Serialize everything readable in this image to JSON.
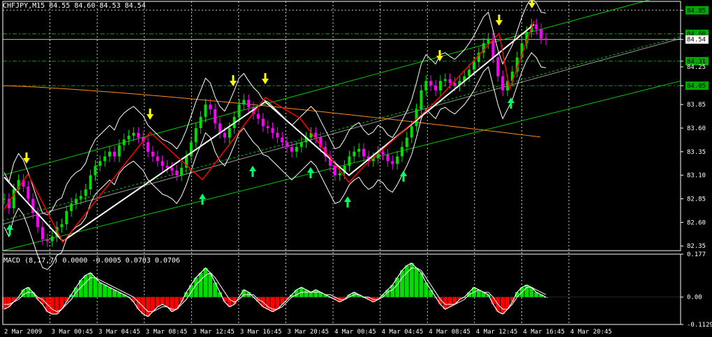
{
  "header": {
    "symbol": "CHFJPY,M15",
    "quote": "84.55 84.60 84.53 84.54"
  },
  "macd_header": {
    "name": "MACD",
    "params": "(8,17,7)",
    "values": "0.0000 -0.0005 0.0703 0.0706"
  },
  "colors": {
    "background": "#000000",
    "axis": "#ffffff",
    "grid": "#ffffff",
    "bull_candle": "#00dd00",
    "bear_candle": "#ff00ff",
    "zigzag_white": "#ffffff",
    "zigzag_red": "#ff0000",
    "channel": "#00cc00",
    "fib_lines": "#00aa00",
    "ma_orange": "#ff8c1a",
    "bollinger": "#ffffff",
    "arrow_down": "#ffff00",
    "arrow_up": "#00ff66",
    "macd_pos": "#00dd00",
    "macd_neg": "#ff0000",
    "price_tag": "#00aa00"
  },
  "chart_data": [
    {
      "type": "candlestick",
      "title": "CHFJPY,M15",
      "x_tick_labels": [
        "2 Mar 2009",
        "3 Mar 00:45",
        "3 Mar 04:45",
        "3 Mar 08:45",
        "3 Mar 12:45",
        "3 Mar 16:45",
        "3 Mar 20:45",
        "4 Mar 00:45",
        "4 Mar 04:45",
        "4 Mar 08:45",
        "4 Mar 12:45",
        "4 Mar 16:45",
        "4 Mar 20:45"
      ],
      "y_tick_labels": [
        "84.85",
        "84.60",
        "84.54",
        "84.31",
        "84.25",
        "84.05",
        "83.85",
        "83.60",
        "83.35",
        "83.10",
        "82.85",
        "82.60",
        "82.35"
      ],
      "ylim": [
        82.3,
        84.9
      ],
      "price_levels": {
        "top_tag": 84.85,
        "current_green": 84.6,
        "current_price": 84.54,
        "fib_1": 84.31,
        "fib_2": 84.05
      },
      "close_path": [
        82.85,
        82.75,
        82.95,
        83.05,
        82.98,
        82.85,
        82.7,
        82.55,
        82.42,
        82.4,
        82.45,
        82.55,
        82.58,
        82.72,
        82.8,
        82.85,
        82.88,
        82.95,
        83.1,
        83.2,
        83.25,
        83.3,
        83.35,
        83.3,
        83.42,
        83.48,
        83.52,
        83.55,
        83.5,
        83.45,
        83.35,
        83.3,
        83.25,
        83.2,
        83.18,
        83.15,
        83.1,
        83.18,
        83.3,
        83.45,
        83.6,
        83.72,
        83.85,
        83.8,
        83.65,
        83.55,
        83.5,
        83.6,
        83.72,
        83.85,
        83.9,
        83.82,
        83.75,
        83.7,
        83.62,
        83.6,
        83.55,
        83.5,
        83.45,
        83.4,
        83.35,
        83.4,
        83.45,
        83.5,
        83.55,
        83.5,
        83.4,
        83.3,
        83.2,
        83.1,
        83.12,
        83.2,
        83.3,
        83.35,
        83.38,
        83.3,
        83.25,
        83.28,
        83.35,
        83.32,
        83.25,
        83.22,
        83.3,
        83.4,
        83.5,
        83.62,
        83.8,
        84.0,
        84.1,
        84.05,
        84.0,
        84.1,
        84.12,
        84.08,
        84.05,
        84.1,
        84.15,
        84.22,
        84.3,
        84.4,
        84.5,
        84.55,
        84.35,
        84.15,
        84.0,
        84.1,
        84.2,
        84.35,
        84.5,
        84.62,
        84.7,
        84.65,
        84.55,
        84.54
      ],
      "zigzag_white": [
        {
          "x": "2 Mar 2009",
          "y": 83.08
        },
        {
          "x": "3 Mar 00:45",
          "y": 82.4
        },
        {
          "x": "3 Mar 20:45",
          "y": 83.88
        },
        {
          "x": "4 Mar 00:45",
          "y": 83.1
        },
        {
          "x": "4 Mar 16:45",
          "y": 84.7
        }
      ],
      "signals_down": [
        "2 Mar 2009",
        "3 Mar 08:45",
        "3 Mar 16:45",
        "3 Mar 16:45",
        "4 Mar 08:45",
        "4 Mar 16:45",
        "4 Mar 16:45"
      ],
      "signals_up": [
        "2 Mar 2009",
        "3 Mar 12:45",
        "3 Mar 16:45",
        "4 Mar 00:45",
        "4 Mar 04:45",
        "4 Mar 04:45",
        "4 Mar 16:45"
      ]
    },
    {
      "type": "bar",
      "title": "MACD (8,17,7)",
      "y_tick_labels": [
        "0.177",
        "0.00",
        "-0.1129"
      ],
      "ylim": [
        -0.1129,
        0.177
      ],
      "histogram": [
        -0.05,
        -0.04,
        -0.02,
        0.0,
        0.03,
        0.04,
        0.02,
        -0.01,
        -0.03,
        -0.06,
        -0.07,
        -0.07,
        -0.05,
        -0.02,
        0.01,
        0.04,
        0.07,
        0.09,
        0.1,
        0.08,
        0.06,
        0.05,
        0.04,
        0.03,
        0.02,
        0.01,
        0.0,
        -0.02,
        -0.05,
        -0.07,
        -0.08,
        -0.06,
        -0.04,
        -0.03,
        -0.04,
        -0.06,
        -0.05,
        -0.02,
        0.02,
        0.05,
        0.08,
        0.1,
        0.12,
        0.1,
        0.06,
        0.02,
        -0.02,
        -0.04,
        -0.03,
        0.0,
        0.03,
        0.02,
        0.0,
        -0.02,
        -0.04,
        -0.05,
        -0.06,
        -0.05,
        -0.03,
        -0.01,
        0.01,
        0.03,
        0.04,
        0.03,
        0.02,
        0.03,
        0.02,
        0.01,
        0.0,
        -0.01,
        -0.02,
        -0.01,
        0.01,
        0.02,
        0.01,
        0.0,
        -0.01,
        -0.02,
        -0.01,
        0.01,
        0.03,
        0.05,
        0.08,
        0.11,
        0.13,
        0.14,
        0.12,
        0.1,
        0.06,
        0.03,
        0.0,
        -0.03,
        -0.05,
        -0.04,
        -0.03,
        -0.01,
        0.0,
        0.02,
        0.04,
        0.03,
        0.02,
        0.01,
        -0.03,
        -0.06,
        -0.07,
        -0.05,
        -0.02,
        0.02,
        0.04,
        0.05,
        0.04,
        0.02,
        0.01,
        0.0
      ],
      "signal": [
        -0.03,
        -0.03,
        -0.02,
        -0.01,
        0.01,
        0.02,
        0.02,
        0.0,
        -0.01,
        -0.03,
        -0.05,
        -0.06,
        -0.05,
        -0.03,
        -0.01,
        0.02,
        0.04,
        0.06,
        0.08,
        0.08,
        0.07,
        0.06,
        0.05,
        0.04,
        0.03,
        0.02,
        0.01,
        0.0,
        -0.02,
        -0.04,
        -0.06,
        -0.06,
        -0.05,
        -0.04,
        -0.04,
        -0.05,
        -0.05,
        -0.03,
        -0.01,
        0.02,
        0.05,
        0.07,
        0.09,
        0.1,
        0.08,
        0.05,
        0.02,
        -0.01,
        -0.02,
        -0.01,
        0.01,
        0.01,
        0.01,
        -0.01,
        -0.02,
        -0.04,
        -0.05,
        -0.05,
        -0.04,
        -0.02,
        0.0,
        0.01,
        0.02,
        0.02,
        0.02,
        0.02,
        0.02,
        0.01,
        0.01,
        0.0,
        -0.01,
        -0.01,
        0.0,
        0.01,
        0.01,
        0.0,
        0.0,
        -0.01,
        -0.01,
        0.0,
        0.02,
        0.03,
        0.05,
        0.08,
        0.1,
        0.12,
        0.12,
        0.11,
        0.08,
        0.05,
        0.02,
        -0.01,
        -0.03,
        -0.03,
        -0.03,
        -0.02,
        -0.01,
        0.01,
        0.02,
        0.03,
        0.02,
        0.02,
        0.0,
        -0.03,
        -0.05,
        -0.05,
        -0.03,
        0.0,
        0.02,
        0.04,
        0.04,
        0.03,
        0.02,
        0.01
      ]
    }
  ]
}
